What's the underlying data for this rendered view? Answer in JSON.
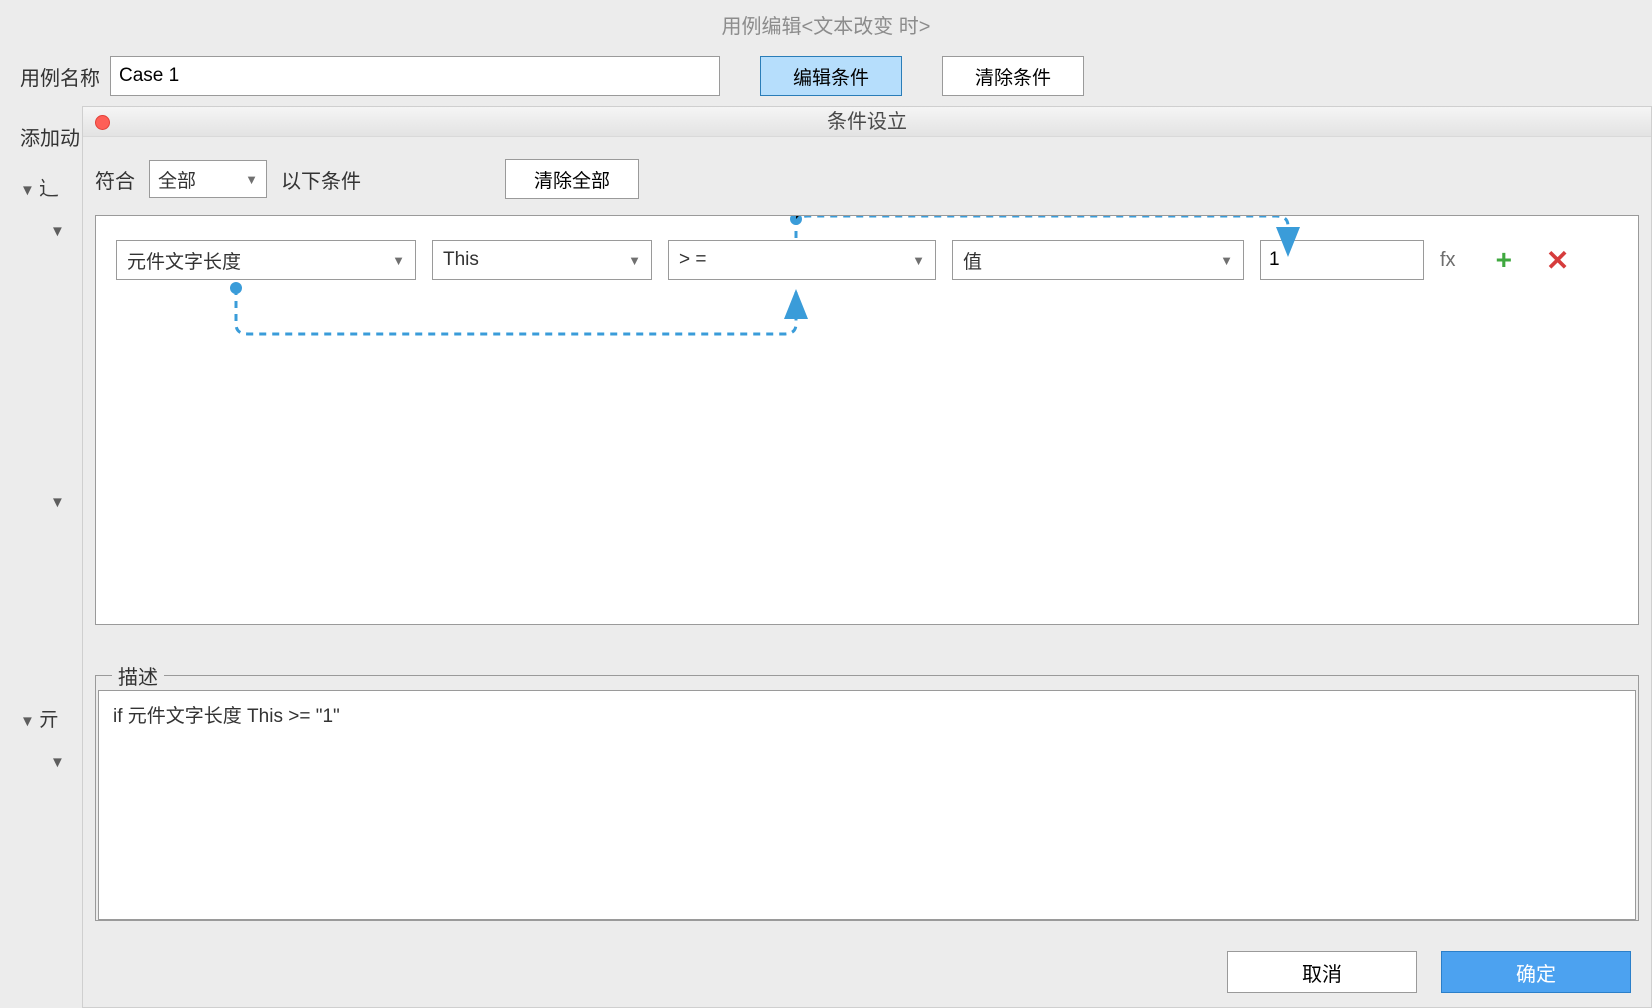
{
  "parent": {
    "title": "用例编辑<文本改变 时>",
    "caseLabel": "用例名称",
    "caseName": "Case 1",
    "editBtn": "编辑条件",
    "clearBtn": "清除条件",
    "addAction": "添加动"
  },
  "tree": {
    "node1": "辶",
    "node2": "亓"
  },
  "modal": {
    "title": "条件设立",
    "matchPrefix": "符合",
    "matchScope": "全部",
    "matchSuffix": "以下条件",
    "clearAll": "清除全部"
  },
  "condition": {
    "field": "元件文字长度",
    "target": "This",
    "operator": "> =",
    "valueType": "值",
    "value": "1",
    "fx": "fx"
  },
  "description": {
    "legend": "描述",
    "text": "if 元件文字长度 This >= \"1\""
  },
  "dialog": {
    "cancel": "取消",
    "ok": "确定"
  }
}
